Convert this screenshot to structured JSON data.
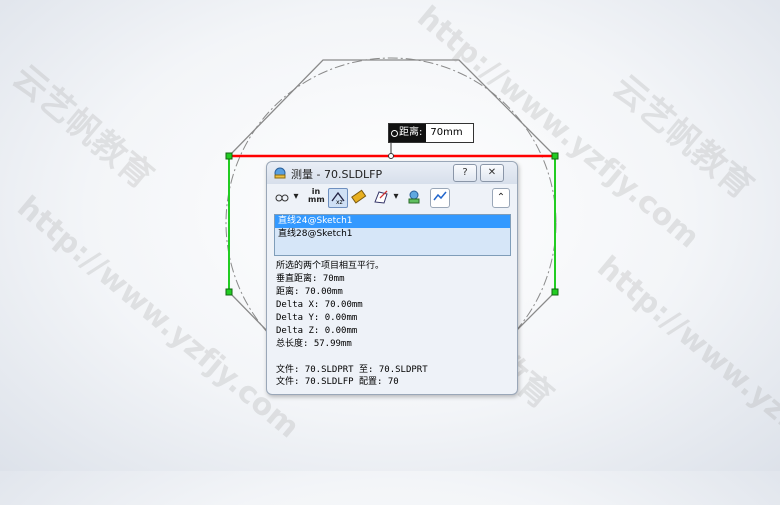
{
  "watermarks": [
    "http://www.yzfjy.com",
    "云艺帆教育"
  ],
  "dimension_tag": {
    "label": "距离:",
    "value": "70mm"
  },
  "dialog": {
    "title": "测量 - 70.SLDLFP",
    "help_label": "?",
    "close_label": "✕",
    "collapse_label": "⌃",
    "toolbar": {
      "units_label_top": "in",
      "units_label_bottom": "mm"
    },
    "selections": [
      "直线24@Sketch1",
      "直线28@Sketch1"
    ],
    "results": {
      "message": "所选的两个项目相互平行。",
      "perp_distance": "垂直距离: 70mm",
      "distance": "距离: 70.00mm",
      "delta_x": "Delta X: 70.00mm",
      "delta_y": "Delta Y: 0.00mm",
      "delta_z": "Delta Z: 0.00mm",
      "total_length": "总长度: 57.99mm"
    },
    "files": {
      "line1": "文件: 70.SLDPRT 至: 70.SLDPRT",
      "line2": "文件: 70.SLDLFP 配置: 70"
    }
  },
  "colors": {
    "selected_edge": "#ff0000",
    "side_edges": "#22cc22",
    "sketch": "#888888",
    "dialog_bg": "#eef2f8",
    "list_selected": "#3399ff"
  }
}
